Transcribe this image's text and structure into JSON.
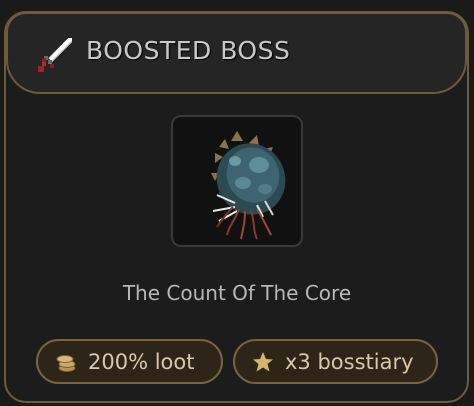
{
  "header": {
    "title": "BOOSTED BOSS",
    "icon": "sword-icon"
  },
  "boss": {
    "name": "The Count Of The Core",
    "portrait_icon": "boss-creature-icon"
  },
  "bonuses": [
    {
      "label": "200% loot",
      "icon": "coins-icon"
    },
    {
      "label": "x3 bosstiary",
      "icon": "star-icon"
    }
  ],
  "colors": {
    "border_gold": "#6f5a3a",
    "pill_background": "#2d2518",
    "accent_gold": "#d9b56a"
  }
}
